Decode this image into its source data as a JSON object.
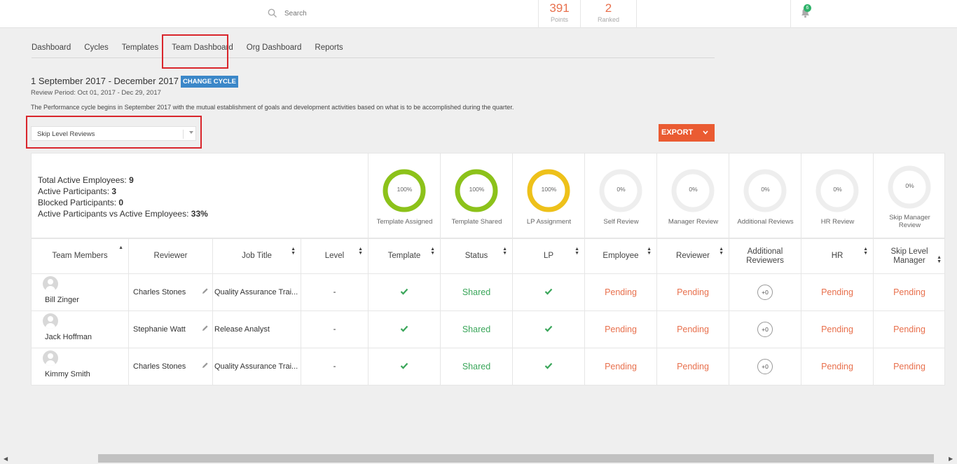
{
  "search": {
    "placeholder": "Search"
  },
  "stats": [
    {
      "value": "391",
      "label": "Points"
    },
    {
      "value": "2",
      "label": "Ranked"
    }
  ],
  "notifications": {
    "count": "6"
  },
  "tabs": [
    "Dashboard",
    "Cycles",
    "Templates",
    "Team Dashboard",
    "Org Dashboard",
    "Reports"
  ],
  "cycle": {
    "title": "1 September 2017 - December 2017",
    "change_label": "CHANGE CYCLE",
    "period": "Review Period: Oct 01, 2017 - Dec 29, 2017",
    "description": "The Performance cycle begins in September 2017 with the mutual establishment of goals and development activities based on what is to be accomplished during the quarter."
  },
  "filter": {
    "selected": "Skip Level Reviews"
  },
  "export_label": "EXPORT",
  "summary": {
    "total_label": "Total Active Employees:",
    "total_value": "9",
    "active_label": "Active Participants:",
    "active_value": "3",
    "blocked_label": "Blocked Participants:",
    "blocked_value": "0",
    "ratio_label": "Active Participants vs Active Employees:",
    "ratio_value": "33%"
  },
  "donuts": [
    {
      "pct": "100%",
      "label": "Template Assigned",
      "color": "#8cc21a",
      "fill": 1.0
    },
    {
      "pct": "100%",
      "label": "Template Shared",
      "color": "#8cc21a",
      "fill": 1.0
    },
    {
      "pct": "100%",
      "label": "LP Assignment",
      "color": "#eec11a",
      "fill": 1.0
    },
    {
      "pct": "0%",
      "label": "Self Review",
      "color": "#eeeeee",
      "fill": 0
    },
    {
      "pct": "0%",
      "label": "Manager Review",
      "color": "#eeeeee",
      "fill": 0
    },
    {
      "pct": "0%",
      "label": "Additional Reviews",
      "color": "#eeeeee",
      "fill": 0
    },
    {
      "pct": "0%",
      "label": "HR Review",
      "color": "#eeeeee",
      "fill": 0
    },
    {
      "pct": "0%",
      "label": "Skip Manager Review",
      "color": "#eeeeee",
      "fill": 0
    }
  ],
  "table": {
    "headers": [
      "Team Members",
      "Reviewer",
      "Job Title",
      "Level",
      "Template",
      "Status",
      "LP",
      "Employee",
      "Reviewer",
      "Additional Reviewers",
      "HR",
      "Skip Level Manager"
    ],
    "rows": [
      {
        "member": "Bill Zinger",
        "reviewer": "Charles Stones",
        "job": "Quality Assurance Trai...",
        "level": "-",
        "status": "Shared",
        "employee": "Pending",
        "reviewer_status": "Pending",
        "additional": "+0",
        "hr": "Pending",
        "skip": "Pending"
      },
      {
        "member": "Jack Hoffman",
        "reviewer": "Stephanie Watt",
        "job": "Release Analyst",
        "level": "-",
        "status": "Shared",
        "employee": "Pending",
        "reviewer_status": "Pending",
        "additional": "+0",
        "hr": "Pending",
        "skip": "Pending"
      },
      {
        "member": "Kimmy Smith",
        "reviewer": "Charles Stones",
        "job": "Quality Assurance Trai...",
        "level": "-",
        "status": "Shared",
        "employee": "Pending",
        "reviewer_status": "Pending",
        "additional": "+0",
        "hr": "Pending",
        "skip": "Pending"
      }
    ]
  }
}
